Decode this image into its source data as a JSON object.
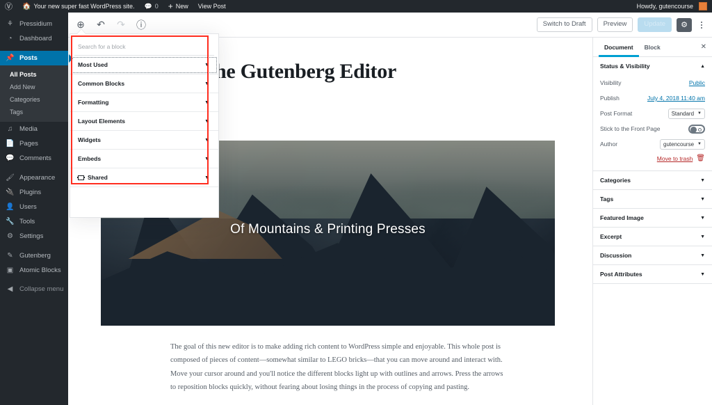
{
  "adminbar": {
    "logo_icon": "wordpress-logo-icon",
    "home_icon": "home-icon",
    "site_name": "Your new super fast WordPress site.",
    "comment_icon": "comment-bubble-icon",
    "comment_count": "0",
    "new_label": "New",
    "view_post_label": "View Post",
    "howdy": "Howdy, gutencourse"
  },
  "adminmenu": {
    "items": [
      {
        "label": "Pressidium",
        "icon": "pressidium-icon"
      },
      {
        "label": "Dashboard",
        "icon": "dashboard-icon"
      },
      {
        "label": "Posts",
        "icon": "pin-icon",
        "current": true
      },
      {
        "label": "Media",
        "icon": "media-icon"
      },
      {
        "label": "Pages",
        "icon": "pages-icon"
      },
      {
        "label": "Comments",
        "icon": "comment-bubble-icon"
      },
      {
        "label": "Appearance",
        "icon": "paintbrush-icon"
      },
      {
        "label": "Plugins",
        "icon": "plugin-icon"
      },
      {
        "label": "Users",
        "icon": "user-icon"
      },
      {
        "label": "Tools",
        "icon": "wrench-icon"
      },
      {
        "label": "Settings",
        "icon": "settings-icon"
      },
      {
        "label": "Gutenberg",
        "icon": "pencil-icon"
      },
      {
        "label": "Atomic Blocks",
        "icon": "atomic-blocks-icon"
      }
    ],
    "submenu": [
      {
        "label": "All Posts",
        "active": true
      },
      {
        "label": "Add New",
        "active": false
      },
      {
        "label": "Categories",
        "active": false
      },
      {
        "label": "Tags",
        "active": false
      }
    ],
    "collapse_label": "Collapse menu",
    "collapse_icon": "collapse-arrow-icon"
  },
  "header": {
    "inserter_icon": "plus-circle-icon",
    "undo_icon": "undo-arrow-icon",
    "redo_icon": "redo-arrow-icon",
    "info_icon": "info-circle-icon",
    "switch_to_draft": "Switch to Draft",
    "preview": "Preview",
    "update": "Update",
    "gear_icon": "gear-icon",
    "more_icon": "ellipsis-vertical-icon"
  },
  "inserter": {
    "search_placeholder": "Search for a block",
    "categories": [
      {
        "label": "Most Used",
        "icon": "",
        "focused": true
      },
      {
        "label": "Common Blocks",
        "icon": "",
        "focused": false
      },
      {
        "label": "Formatting",
        "icon": "",
        "focused": false
      },
      {
        "label": "Layout Elements",
        "icon": "",
        "focused": false
      },
      {
        "label": "Widgets",
        "icon": "",
        "focused": false
      },
      {
        "label": "Embeds",
        "icon": "",
        "focused": false
      },
      {
        "label": "Shared",
        "icon": "shared-blocks-icon",
        "focused": false
      }
    ],
    "caret_icon": "chevron-down-icon",
    "highlight_color": "#ff2d1f"
  },
  "canvas": {
    "post_title": "Welcome to the Gutenberg Editor",
    "cover_caption": "Of Mountains & Printing Presses",
    "paragraph": "The goal of this new editor is to make adding rich content to WordPress simple and enjoyable. This whole post is composed of pieces of content—somewhat similar to LEGO bricks—that you can move around and interact with. Move your cursor around and you'll notice the different blocks light up with outlines and arrows. Press the arrows to reposition blocks quickly, without fearing about losing things in the process of copying and pasting."
  },
  "settings": {
    "tabs": [
      {
        "label": "Document",
        "active": true
      },
      {
        "label": "Block",
        "active": false
      }
    ],
    "close_icon": "close-icon",
    "status_panel": {
      "title": "Status & Visibility",
      "collapse_icon": "chevron-up-icon",
      "visibility_label": "Visibility",
      "visibility_value": "Public",
      "publish_label": "Publish",
      "publish_value": "July 4, 2018 11:40 am",
      "post_format_label": "Post Format",
      "post_format_value": "Standard",
      "sticky_label": "Stick to the Front Page",
      "author_label": "Author",
      "author_value": "gutencourse",
      "trash_label": "Move to trash",
      "trash_icon": "trash-icon"
    },
    "panels": [
      {
        "label": "Categories",
        "icon": "chevron-down-icon"
      },
      {
        "label": "Tags",
        "icon": "chevron-down-icon"
      },
      {
        "label": "Featured Image",
        "icon": "chevron-down-icon"
      },
      {
        "label": "Excerpt",
        "icon": "chevron-down-icon"
      },
      {
        "label": "Discussion",
        "icon": "chevron-down-icon"
      },
      {
        "label": "Post Attributes",
        "icon": "chevron-down-icon"
      }
    ]
  },
  "colors": {
    "admin_dark": "#23282d",
    "admin_blue": "#0073aa",
    "accent_blue": "#00a0d2",
    "link_blue": "#0073aa",
    "danger_red": "#b52727",
    "highlight_red": "#ff2d1f"
  }
}
